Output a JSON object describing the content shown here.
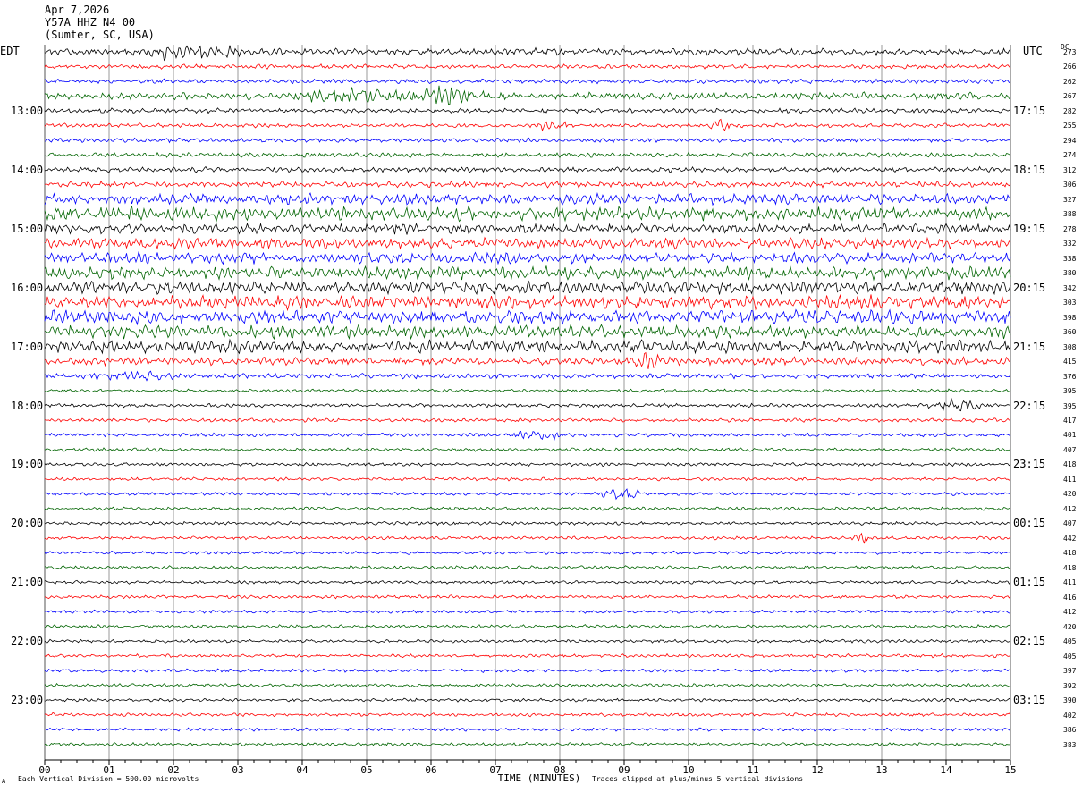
{
  "header": {
    "date": "Apr 7,2026",
    "station": "Y57A HHZ N4 00",
    "location": "(Sumter, SC, USA)"
  },
  "left_label": "EDT",
  "right_label": "UTC",
  "dc_label": "DC",
  "footer": {
    "scale_note": "Each Vertical Division =  500.00 microvolts",
    "clip_note": "Traces clipped at plus/minus 5 vertical divisions",
    "corner_mark": "A"
  },
  "colors": {
    "black": "#000000",
    "red": "#ff0000",
    "blue": "#0000ff",
    "green": "#006400",
    "grid": "#555555"
  },
  "chart_data": {
    "type": "line",
    "title": "Apr 7,2026 Y57A HHZ N4 00 (Sumter, SC, USA)",
    "xlabel": "TIME (MINUTES)",
    "ylabel_left": "EDT",
    "ylabel_right": "UTC",
    "x_ticks": [
      "00",
      "01",
      "02",
      "03",
      "04",
      "05",
      "06",
      "07",
      "08",
      "09",
      "10",
      "11",
      "12",
      "13",
      "14",
      "15"
    ],
    "xlim": [
      0,
      15
    ],
    "trace_count": 48,
    "traces_per_hour": 4,
    "color_cycle": [
      "black",
      "red",
      "blue",
      "green"
    ],
    "left_hour_labels": [
      {
        "trace": 4,
        "label": "13:00"
      },
      {
        "trace": 8,
        "label": "14:00"
      },
      {
        "trace": 12,
        "label": "15:00"
      },
      {
        "trace": 16,
        "label": "16:00"
      },
      {
        "trace": 20,
        "label": "17:00"
      },
      {
        "trace": 24,
        "label": "18:00"
      },
      {
        "trace": 28,
        "label": "19:00"
      },
      {
        "trace": 32,
        "label": "20:00"
      },
      {
        "trace": 36,
        "label": "21:00"
      },
      {
        "trace": 40,
        "label": "22:00"
      },
      {
        "trace": 44,
        "label": "23:00"
      }
    ],
    "right_hour_labels": [
      {
        "trace": 4,
        "label": "17:15"
      },
      {
        "trace": 8,
        "label": "18:15"
      },
      {
        "trace": 12,
        "label": "19:15"
      },
      {
        "trace": 16,
        "label": "20:15"
      },
      {
        "trace": 20,
        "label": "21:15"
      },
      {
        "trace": 24,
        "label": "22:15"
      },
      {
        "trace": 28,
        "label": "23:15"
      },
      {
        "trace": 32,
        "label": "00:15"
      },
      {
        "trace": 36,
        "label": "01:15"
      },
      {
        "trace": 40,
        "label": "02:15"
      },
      {
        "trace": 44,
        "label": "03:15"
      }
    ],
    "dc_offsets": [
      273,
      266,
      262,
      267,
      282,
      255,
      294,
      274,
      312,
      306,
      327,
      388,
      278,
      332,
      338,
      380,
      342,
      303,
      398,
      360,
      308,
      415,
      376,
      395,
      395,
      417,
      401,
      407,
      418,
      411,
      420,
      412,
      407,
      442,
      418,
      418,
      411,
      416,
      412,
      420,
      405,
      405,
      397,
      392,
      390,
      402,
      386,
      383
    ],
    "noise_level": [
      1.4,
      0.9,
      0.9,
      1.5,
      1.0,
      0.9,
      0.9,
      1.0,
      1.1,
      1.2,
      2.2,
      2.8,
      2.0,
      2.2,
      2.2,
      2.6,
      2.6,
      2.8,
      2.8,
      2.7,
      2.6,
      1.6,
      1.1,
      0.7,
      0.8,
      0.8,
      0.8,
      0.7,
      0.7,
      0.7,
      0.7,
      0.7,
      0.7,
      0.7,
      0.7,
      0.7,
      0.7,
      0.7,
      0.7,
      0.7,
      0.7,
      0.7,
      0.7,
      0.7,
      0.7,
      0.7,
      0.7,
      0.7
    ],
    "events": [
      {
        "trace": 0,
        "minute": 2.3,
        "amp": 4.0,
        "dur": 0.8
      },
      {
        "trace": 3,
        "minute": 4.8,
        "amp": 2.6,
        "dur": 1.0
      },
      {
        "trace": 3,
        "minute": 6.2,
        "amp": 3.2,
        "dur": 0.7
      },
      {
        "trace": 5,
        "minute": 7.9,
        "amp": 2.2,
        "dur": 0.3
      },
      {
        "trace": 5,
        "minute": 10.5,
        "amp": 2.0,
        "dur": 0.2
      },
      {
        "trace": 12,
        "minute": 5.5,
        "amp": 3.0,
        "dur": 0.2
      },
      {
        "trace": 21,
        "minute": 9.4,
        "amp": 2.6,
        "dur": 0.4
      },
      {
        "trace": 22,
        "minute": 1.3,
        "amp": 1.8,
        "dur": 0.8
      },
      {
        "trace": 24,
        "minute": 14.2,
        "amp": 2.2,
        "dur": 0.6
      },
      {
        "trace": 26,
        "minute": 7.7,
        "amp": 2.0,
        "dur": 0.5
      },
      {
        "trace": 30,
        "minute": 9.0,
        "amp": 2.0,
        "dur": 0.5
      },
      {
        "trace": 33,
        "minute": 12.7,
        "amp": 2.0,
        "dur": 0.2
      }
    ]
  }
}
